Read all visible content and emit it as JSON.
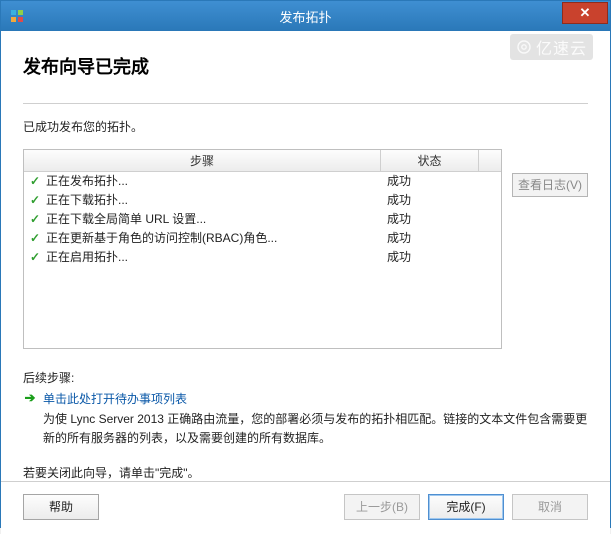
{
  "window": {
    "title": "发布拓扑"
  },
  "watermark": "亿速云",
  "heading": "发布向导已完成",
  "status_text": "已成功发布您的拓扑。",
  "table": {
    "col_step": "步骤",
    "col_status": "状态"
  },
  "steps": [
    {
      "label": "正在发布拓扑...",
      "status": "成功"
    },
    {
      "label": "正在下载拓扑...",
      "status": "成功"
    },
    {
      "label": "正在下载全局简单 URL 设置...",
      "status": "成功"
    },
    {
      "label": "正在更新基于角色的访问控制(RBAC)角色...",
      "status": "成功"
    },
    {
      "label": "正在启用拓扑...",
      "status": "成功"
    }
  ],
  "view_logs": "查看日志(V)",
  "next_steps": {
    "label": "后续步骤:",
    "link": "单击此处打开待办事项列表",
    "desc": "为使 Lync Server 2013 正确路由流量，您的部署必须与发布的拓扑相匹配。链接的文本文件包含需要更新的所有服务器的列表，以及需要创建的所有数据库。"
  },
  "close_hint": "若要关闭此向导，请单击\"完成\"。",
  "footer": {
    "help": "帮助",
    "back": "上一步(B)",
    "finish": "完成(F)",
    "cancel": "取消"
  }
}
